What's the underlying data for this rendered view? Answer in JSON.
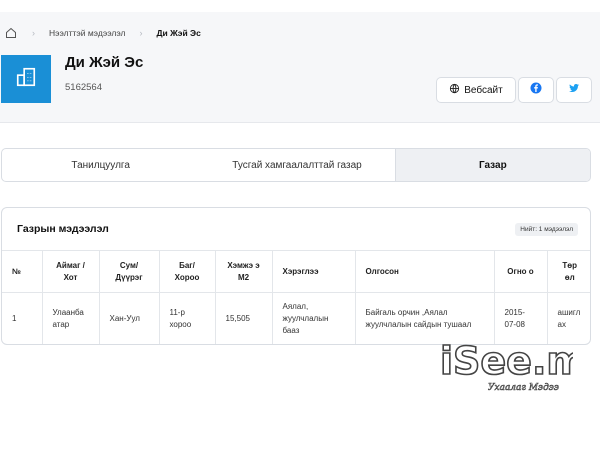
{
  "breadcrumb": {
    "parent": "Нээлттэй мэдээлэл",
    "current": "Ди Жэй Эс"
  },
  "company": {
    "name": "Ди Жэй Эс",
    "code": "5162564"
  },
  "buttons": {
    "website": "Вебсайт"
  },
  "tabs": [
    {
      "label": "Танилцуулга"
    },
    {
      "label": "Тусгай хамгаалалттай газар"
    },
    {
      "label": "Газар"
    }
  ],
  "land_card": {
    "title": "Газрын мэдээлэл",
    "total": "Нийт: 1 мэдээлэл",
    "headers": {
      "num": "№",
      "aimag": "Аймаг /Хот",
      "sum": "Сум/ Дүүрэг",
      "bag": "Баг/ Хороо",
      "size": "Хэмжэ э М2",
      "usage": "Хэрэглээ",
      "obtained": "Олгосон",
      "date": "Огно о",
      "type": "Төр өл"
    },
    "rows": [
      {
        "num": "1",
        "aimag": "Улаанба атар",
        "sum": "Хан-Уул",
        "bag": "11-р хороо",
        "size": "15,505",
        "usage": "Аялал, жуулчлалын бааз",
        "obtained": "Байгаль орчин ,Аялал жуулчлалын сайдын тушаал",
        "date": "2015- 07-08",
        "type": "ашигл ах"
      }
    ]
  },
  "watermark": {
    "text": "iSee.mn",
    "tagline": "Ухаалаг Мэдээ"
  },
  "colors": {
    "brand": "#1a8fd6",
    "facebook": "#1877f2",
    "twitter": "#1da1f2"
  }
}
